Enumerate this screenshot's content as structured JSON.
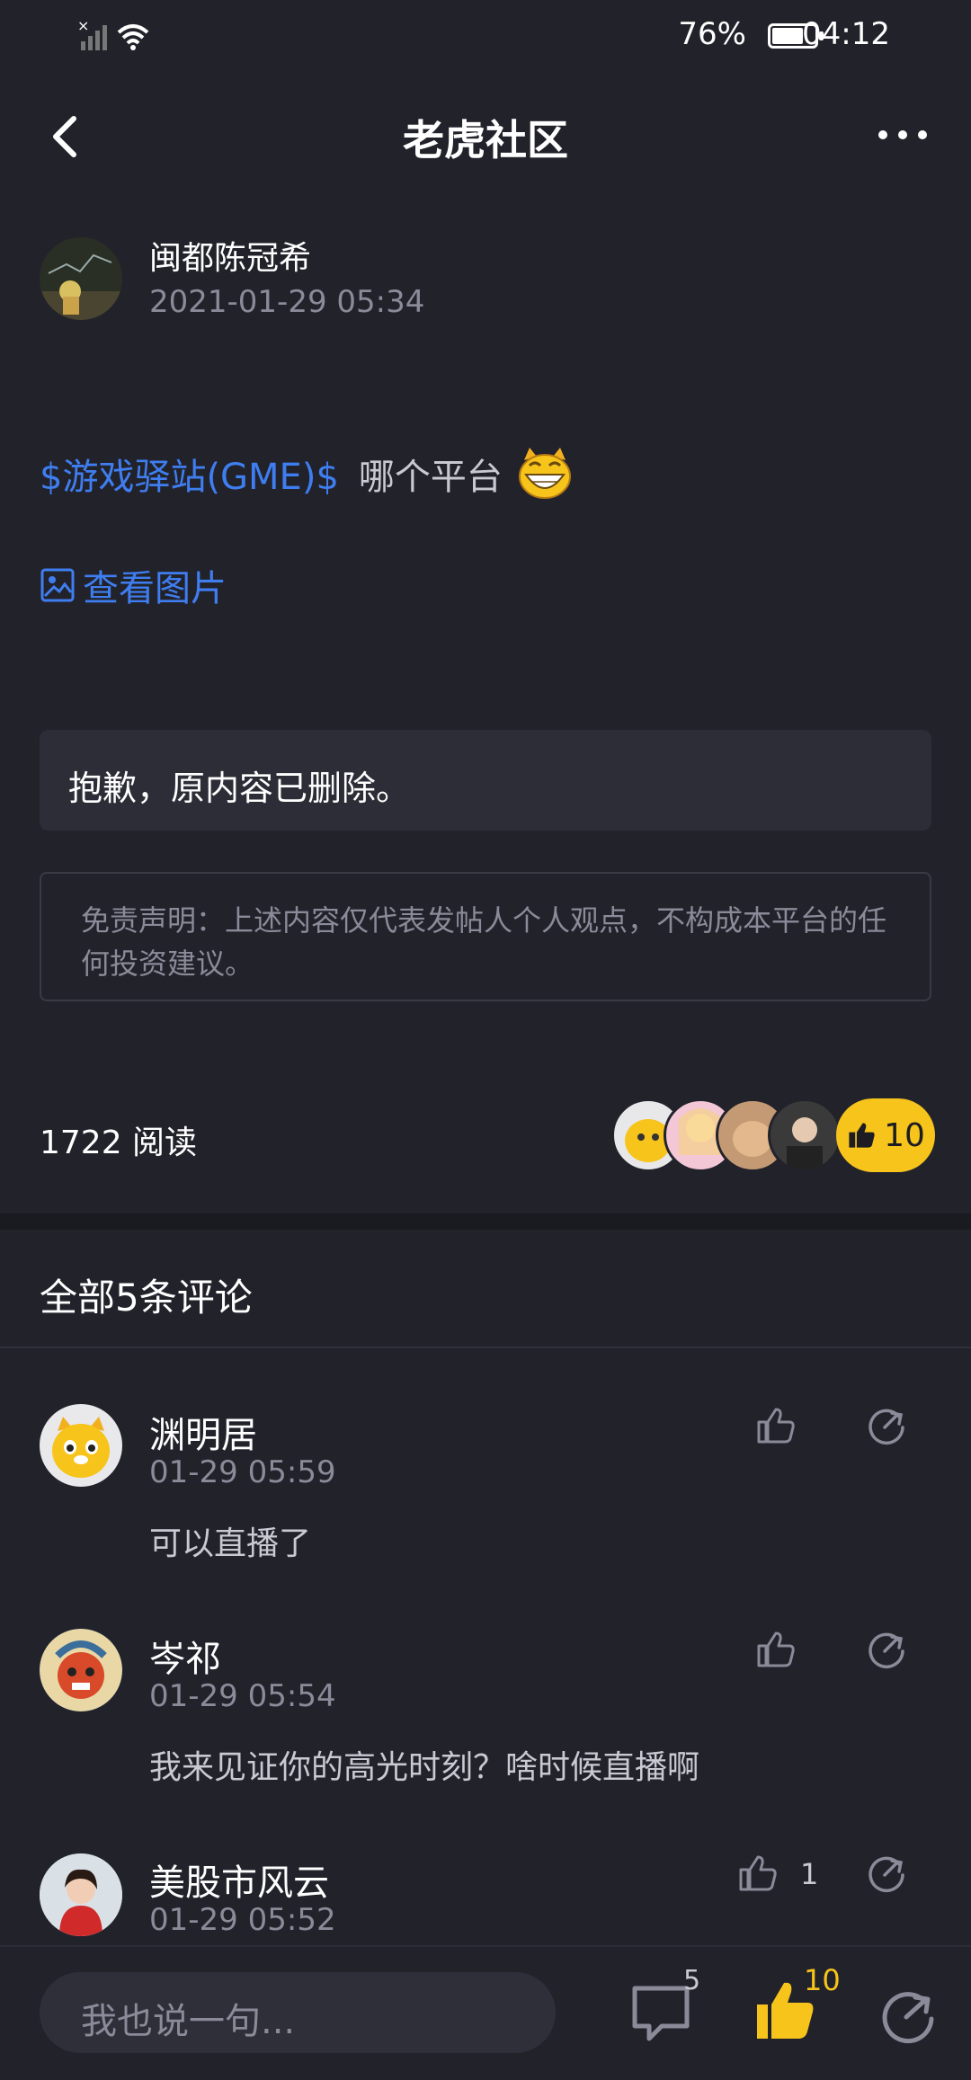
{
  "status_bar": {
    "battery": "76%",
    "time": "04:12"
  },
  "header": {
    "title": "老虎社区"
  },
  "post": {
    "author": "闽都陈冠希",
    "time": "2021-01-29 05:34",
    "ticker": "$游戏驿站(GME)$",
    "text": "哪个平台",
    "view_image": "查看图片",
    "deleted_notice": "抱歉，原内容已删除。",
    "disclaimer": "免责声明：上述内容仅代表发帖人个人观点，不构成本平台的任何投资建议。",
    "reads": "1722 阅读",
    "likes": "10"
  },
  "comments_title": "全部5条评论",
  "comments": [
    {
      "name": "渊明居",
      "time": "01-29 05:59",
      "text": "可以直播了",
      "likes": ""
    },
    {
      "name": "岑祁",
      "time": "01-29 05:54",
      "text": "我来见证你的高光时刻？啥时候直播啊",
      "likes": ""
    },
    {
      "name": "美股市风云",
      "time": "01-29 05:52",
      "text": "",
      "likes": "1"
    }
  ],
  "bottom_bar": {
    "input_placeholder": "我也说一句...",
    "comment_count": "5",
    "like_count": "10"
  },
  "colors": {
    "background": "#22222b",
    "link": "#3f7ef0",
    "accent": "#f6c41b",
    "muted": "#8a8a99"
  },
  "icons": [
    "back-icon",
    "more-icon",
    "image-icon",
    "thumbs-up-icon",
    "share-icon",
    "comment-icon",
    "tiger-emoji-icon"
  ]
}
